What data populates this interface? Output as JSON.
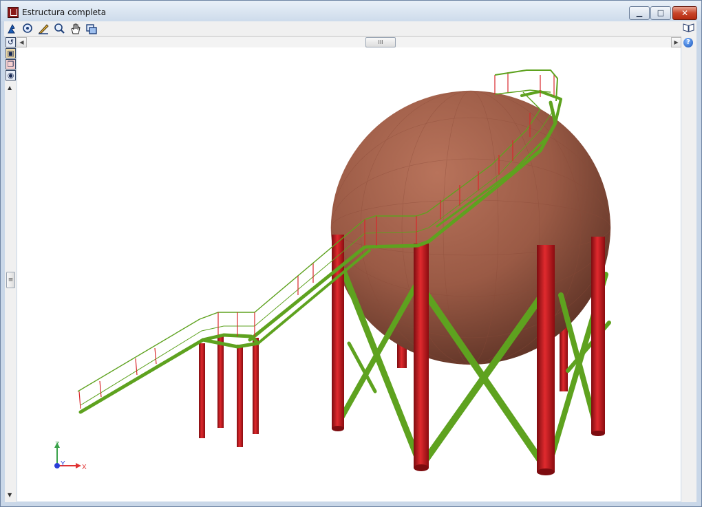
{
  "window": {
    "title": "Estructura completa",
    "controls": {
      "minimize": "▁",
      "maximize": "□",
      "close": "✕"
    }
  },
  "toolbar": {
    "icons": [
      "select-tool-icon",
      "zoom-window-icon",
      "edit-pen-icon",
      "zoom-icon",
      "pan-hand-icon",
      "views-icon"
    ]
  },
  "left_toolbar": {
    "icons": [
      "rotate-icon",
      "cube-view-icon",
      "layers-view-icon",
      "visibility-icon"
    ]
  },
  "scrollbar": {
    "thumb_grip": "III",
    "v_thumb_grip": "≡"
  },
  "axes": {
    "z": "Z",
    "y": "Y",
    "x": "X"
  },
  "colors": {
    "column": "#c4141b",
    "bracing": "#5ea21f",
    "sphere": "#a86650",
    "background": "#ffffff"
  }
}
